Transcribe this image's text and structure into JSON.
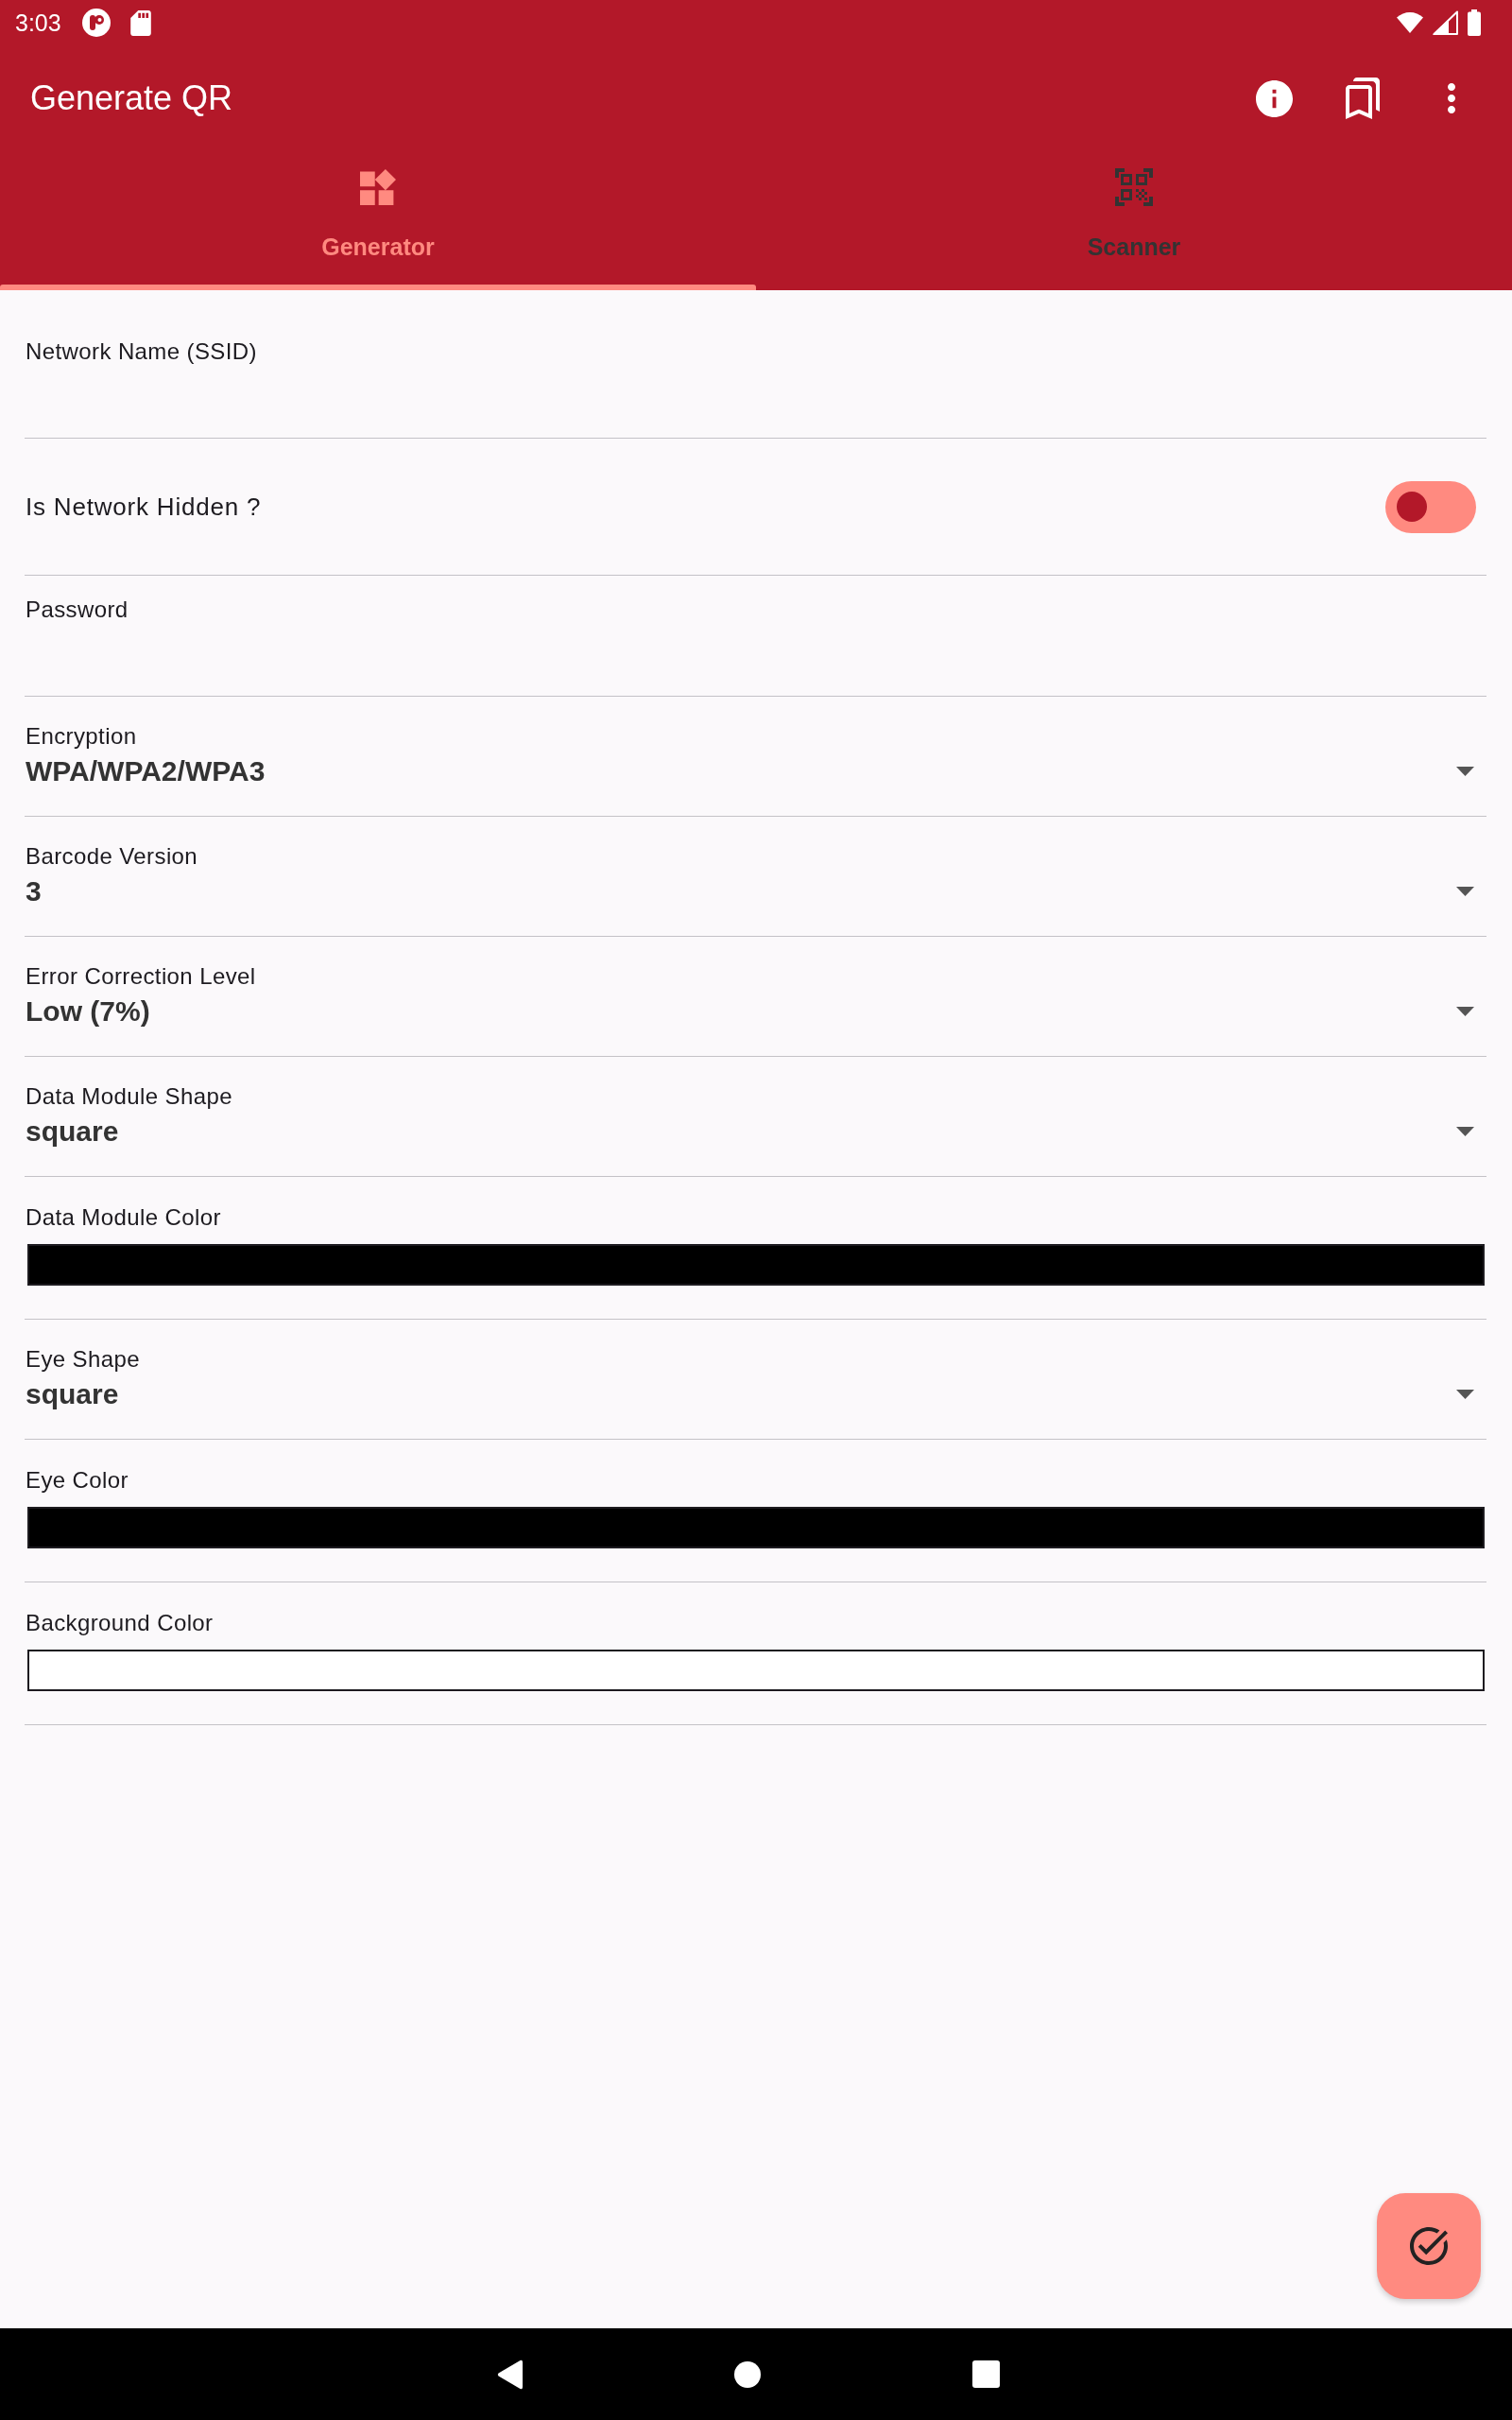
{
  "status_bar": {
    "time": "3:03"
  },
  "app_bar": {
    "title": "Generate QR"
  },
  "tabs": [
    {
      "kind": "generator",
      "label": "Generator",
      "selected": true
    },
    {
      "kind": "scanner",
      "label": "Scanner",
      "selected": false
    }
  ],
  "form": {
    "fields": [
      {
        "kind": "text",
        "label": "Network Name (SSID)"
      },
      {
        "kind": "switch",
        "label": "Is Network Hidden ?",
        "on": false
      },
      {
        "kind": "text",
        "label": "Password"
      },
      {
        "kind": "dropdown",
        "label": "Encryption",
        "value": "WPA/WPA2/WPA3"
      },
      {
        "kind": "dropdown",
        "label": "Barcode Version",
        "value": "3"
      },
      {
        "kind": "dropdown",
        "label": "Error Correction Level",
        "value": "Low (7%)"
      },
      {
        "kind": "dropdown",
        "label": "Data Module Shape",
        "value": "square"
      },
      {
        "kind": "color",
        "label": "Data Module Color",
        "color": "#000000"
      },
      {
        "kind": "dropdown",
        "label": "Eye Shape",
        "value": "square"
      },
      {
        "kind": "color",
        "label": "Eye Color",
        "color": "#000000"
      },
      {
        "kind": "color",
        "label": "Background Color",
        "color": "#ffffff"
      }
    ]
  }
}
